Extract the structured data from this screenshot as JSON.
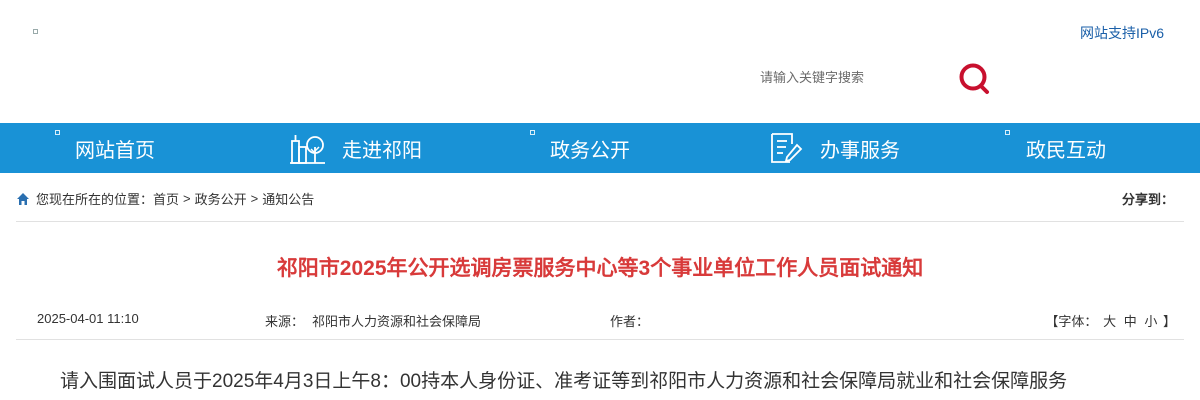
{
  "header": {
    "ipv6_label": "网站支持IPv6",
    "search": {
      "placeholder": "请输入关键字搜索"
    }
  },
  "colors": {
    "nav_bg": "#1992d6",
    "title_red": "#d83a3a",
    "search_icon": "#c8102e"
  },
  "nav": {
    "items": [
      {
        "label": "网站首页",
        "icon": "none"
      },
      {
        "label": "走进祁阳",
        "icon": "city-icon"
      },
      {
        "label": "政务公开",
        "icon": "none"
      },
      {
        "label": "办事服务",
        "icon": "document-pen-icon"
      },
      {
        "label": "政民互动",
        "icon": "none"
      }
    ]
  },
  "breadcrumb": {
    "prefix": "您现在所在的位置：",
    "items": [
      "首页",
      "政务公开",
      "通知公告"
    ],
    "separator": ">",
    "share_label": "分享到："
  },
  "article": {
    "title": "祁阳市2025年公开选调房票服务中心等3个事业单位工作人员面试通知",
    "date": "2025-04-01 11:10",
    "source_label": "来源：",
    "source": "祁阳市人力资源和社会保障局",
    "author_label": "作者：",
    "font_prefix": "【字体：",
    "font_sizes": [
      "大",
      "中",
      "小"
    ],
    "font_suffix": "】",
    "body_first_line": "请入围面试人员于2025年4月3日上午8：00持本人身份证、准考证等到祁阳市人力资源和社会保障局就业和社会保障服务"
  }
}
